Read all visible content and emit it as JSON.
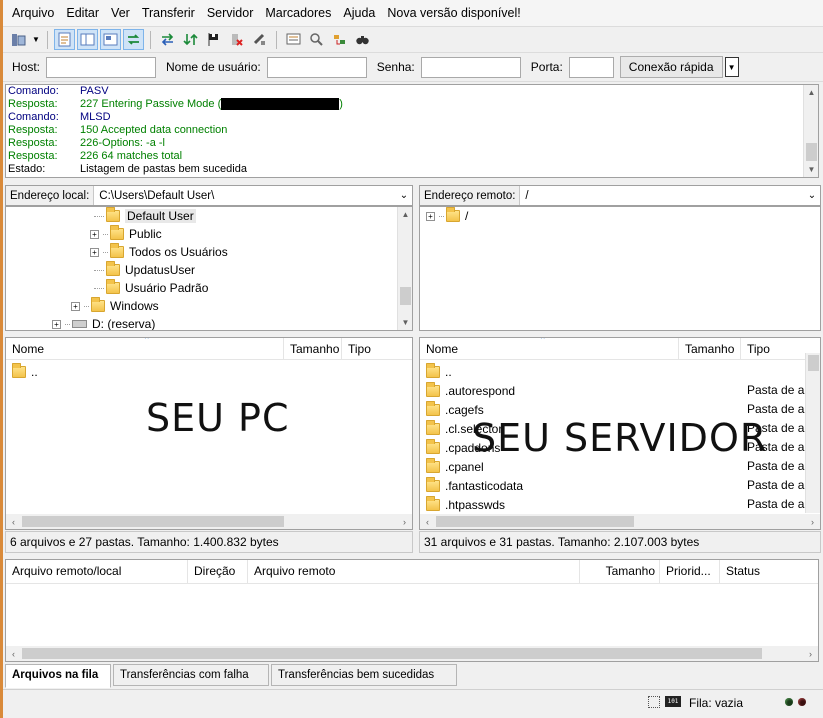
{
  "menu": [
    "Arquivo",
    "Editar",
    "Ver",
    "Transferir",
    "Servidor",
    "Marcadores",
    "Ajuda",
    "Nova versão disponível!"
  ],
  "quickconnect": {
    "host_label": "Host:",
    "user_label": "Nome de usuário:",
    "pass_label": "Senha:",
    "port_label": "Porta:",
    "host_value": "",
    "user_value": "",
    "pass_value": "",
    "port_value": "",
    "button": "Conexão rápida"
  },
  "log": [
    {
      "kind": "Comando:",
      "text": "PASV",
      "type": "cmd"
    },
    {
      "kind": "Resposta:",
      "text": "227 Entering Passive Mode (",
      "suffix": ")",
      "redacted": true,
      "type": "resp"
    },
    {
      "kind": "Comando:",
      "text": "MLSD",
      "type": "cmd"
    },
    {
      "kind": "Resposta:",
      "text": "150 Accepted data connection",
      "type": "resp"
    },
    {
      "kind": "Resposta:",
      "text": "226-Options: -a -l",
      "type": "resp"
    },
    {
      "kind": "Resposta:",
      "text": "226 64 matches total",
      "type": "resp"
    },
    {
      "kind": "Estado:",
      "text": "Listagem de pastas bem sucedida",
      "type": "status"
    }
  ],
  "local": {
    "address_label": "Endereço local:",
    "address_value": "C:\\Users\\Default User\\",
    "tree": {
      "default_user": "Default User",
      "public": "Public",
      "todos": "Todos os Usuários",
      "updatus": "UpdatusUser",
      "usuario_padrao": "Usuário Padrão",
      "windows": "Windows",
      "drive_d": "D: (reserva)"
    },
    "columns": {
      "name": "Nome",
      "size": "Tamanho",
      "type": "Tipo"
    },
    "files": [
      ".."
    ],
    "status": "6 arquivos e 27 pastas. Tamanho: 1.400.832 bytes",
    "overlay": "SEU PC"
  },
  "remote": {
    "address_label": "Endereço remoto:",
    "address_value": "/",
    "tree_root": "/",
    "columns": {
      "name": "Nome",
      "size": "Tamanho",
      "type": "Tipo"
    },
    "files": [
      {
        "name": "..",
        "type": ""
      },
      {
        "name": ".autorespond",
        "type": "Pasta de ar"
      },
      {
        "name": ".cagefs",
        "type": "Pasta de ar"
      },
      {
        "name": ".cl.selector",
        "type": "Pasta de ar"
      },
      {
        "name": ".cpaddons",
        "type": "Pasta de ar"
      },
      {
        "name": ".cpanel",
        "type": "Pasta de ar"
      },
      {
        "name": ".fantasticodata",
        "type": "Pasta de ar"
      },
      {
        "name": ".htpasswds",
        "type": "Pasta de ar"
      }
    ],
    "status": "31 arquivos e 31 pastas. Tamanho: 2.107.003 bytes",
    "overlay": "SEU SERVIDOR"
  },
  "queue": {
    "columns": [
      "Arquivo remoto/local",
      "Direção",
      "Arquivo remoto",
      "Tamanho",
      "Priorid...",
      "Status"
    ]
  },
  "tabs": [
    "Arquivos na fila",
    "Transferências com falha",
    "Transferências bem sucedidas"
  ],
  "statusbar": {
    "queue": "Fila: vazia"
  },
  "colors": {
    "command": "#000080",
    "response": "#008000",
    "frame": "#d98a3a"
  }
}
